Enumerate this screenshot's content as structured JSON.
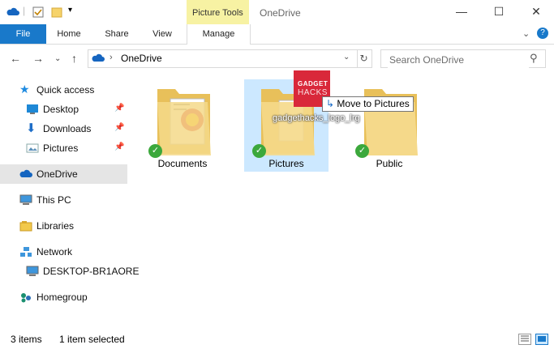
{
  "window": {
    "title": "OneDrive",
    "contextual_tab": "Picture Tools"
  },
  "ribbon": {
    "tabs": [
      "File",
      "Home",
      "Share",
      "View",
      "Manage"
    ]
  },
  "address": {
    "location": "OneDrive",
    "search_placeholder": "Search OneDrive"
  },
  "sidebar": {
    "items": [
      {
        "label": "Quick access"
      },
      {
        "label": "Desktop"
      },
      {
        "label": "Downloads"
      },
      {
        "label": "Pictures"
      },
      {
        "label": "OneDrive"
      },
      {
        "label": "This PC"
      },
      {
        "label": "Libraries"
      },
      {
        "label": "Network"
      },
      {
        "label": "DESKTOP-BR1AORE"
      },
      {
        "label": "Homegroup"
      }
    ]
  },
  "content": {
    "folders": [
      {
        "name": "Documents"
      },
      {
        "name": "Pictures"
      },
      {
        "name": "Public"
      }
    ],
    "drag": {
      "thumb_line1": "GADGET",
      "thumb_line2": "HACKS",
      "file_name": "gadgethacks_logo_lrg",
      "tooltip": "Move to Pictures"
    }
  },
  "status": {
    "items_count": "3 items",
    "selection": "1 item selected"
  },
  "colors": {
    "file_tab": "#1979ca",
    "picture_tools": "#f7f2a3",
    "selected_nav": "#e5e5e5",
    "selected_item": "#cce8ff",
    "sync_check": "#3ca83c"
  }
}
